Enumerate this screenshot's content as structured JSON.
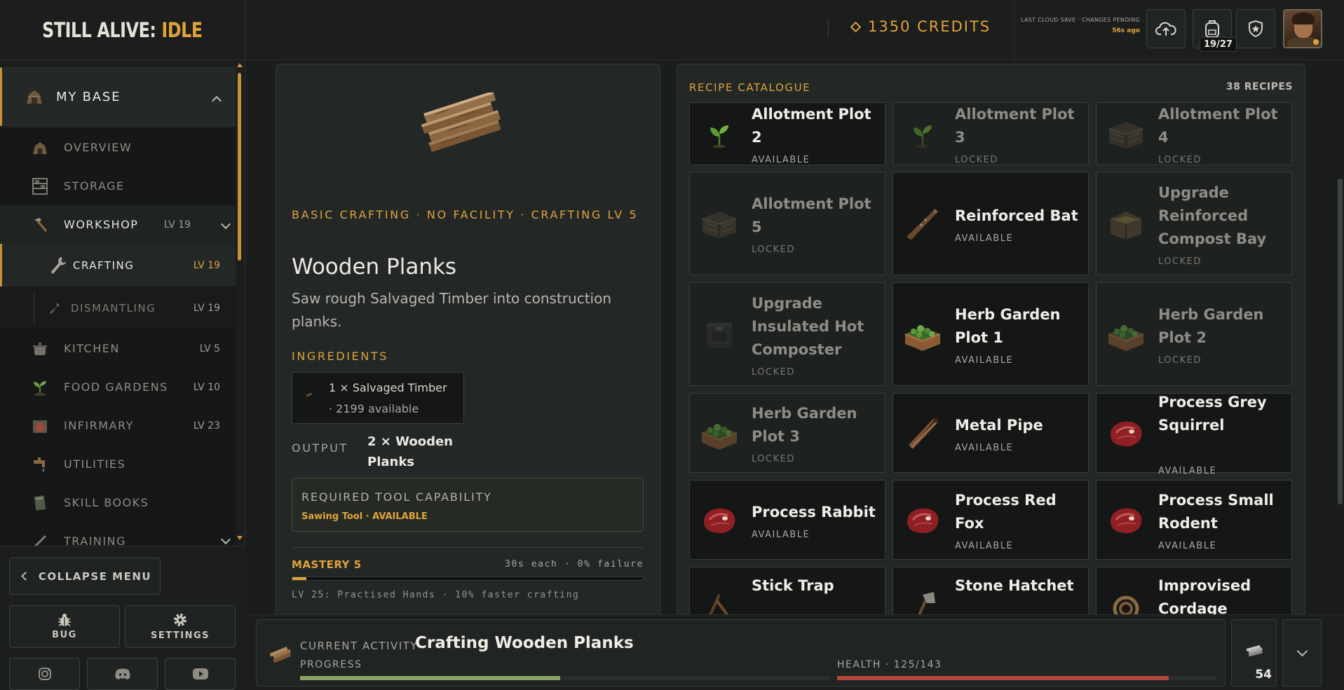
{
  "header": {
    "logo_main": "STILL ALIVE: ",
    "logo_accent": "IDLE",
    "credits": "1350 CREDITS",
    "save_label": "LAST CLOUD SAVE · CHANGES PENDING",
    "save_time": "56s ago",
    "inventory_count": "19/27",
    "icons": [
      "cloud-upload-icon",
      "backpack-icon",
      "shield-star-icon"
    ]
  },
  "sidebar": {
    "section": "MY BASE",
    "items": [
      {
        "label": "OVERVIEW",
        "level": ""
      },
      {
        "label": "STORAGE",
        "level": ""
      },
      {
        "label": "WORKSHOP",
        "level": "LV 19"
      },
      {
        "label": "CRAFTING",
        "level": "LV 19"
      },
      {
        "label": "DISMANTLING",
        "level": "LV 19"
      },
      {
        "label": "KITCHEN",
        "level": "LV 5"
      },
      {
        "label": "FOOD GARDENS",
        "level": "LV 10"
      },
      {
        "label": "INFIRMARY",
        "level": "LV 23"
      },
      {
        "label": "UTILITIES",
        "level": ""
      },
      {
        "label": "SKILL BOOKS",
        "level": ""
      },
      {
        "label": "TRAINING",
        "level": ""
      }
    ],
    "collapse_label": "COLLAPSE MENU",
    "bug_label": "BUG",
    "settings_label": "SETTINGS",
    "social": [
      "instagram-icon",
      "discord-icon",
      "youtube-icon"
    ]
  },
  "detail": {
    "meta": "BASIC CRAFTING · NO FACILITY · CRAFTING LV 5",
    "name": "Wooden Planks",
    "description": "Saw rough Salvaged Timber into construction planks.",
    "ingredients_title": "INGREDIENTS",
    "ingredient_line": "1 × Salvaged Timber",
    "ingredient_available": "2199 available",
    "output_label": "OUTPUT",
    "output_value": "2 × Wooden Planks",
    "tool_title": "REQUIRED TOOL CAPABILITY",
    "tool_status": "Sawing Tool · AVAILABLE",
    "mastery_label": "MASTERY 5",
    "mastery_info": "30s each · 0% failure",
    "mastery_progress": 0.04,
    "mastery_perk": "LV 25: Practised Hands · 10% faster crafting"
  },
  "catalogue": {
    "title": "RECIPE CATALOGUE",
    "count": "38 RECIPES",
    "recipes": [
      {
        "name": "Allotment Plot 2",
        "status": "AVAILABLE",
        "locked": false,
        "icon": "sprout-icon"
      },
      {
        "name": "Allotment Plot 3",
        "status": "LOCKED",
        "locked": true,
        "icon": "sprout-icon"
      },
      {
        "name": "Allotment Plot 4",
        "status": "LOCKED",
        "locked": true,
        "icon": "crate-icon"
      },
      {
        "name": "Allotment Plot 5",
        "status": "LOCKED",
        "locked": true,
        "icon": "crate-icon"
      },
      {
        "name": "Reinforced Bat",
        "status": "AVAILABLE",
        "locked": false,
        "icon": "bat-icon"
      },
      {
        "name": "Upgrade Reinforced Compost Bay",
        "status": "LOCKED",
        "locked": true,
        "icon": "compost-bin-icon"
      },
      {
        "name": "Upgrade Insulated Hot Composter",
        "status": "LOCKED",
        "locked": true,
        "icon": "composter-icon"
      },
      {
        "name": "Herb Garden Plot 1",
        "status": "AVAILABLE",
        "locked": false,
        "icon": "herb-planter-icon"
      },
      {
        "name": "Herb Garden Plot 2",
        "status": "LOCKED",
        "locked": true,
        "icon": "herb-planter-icon"
      },
      {
        "name": "Herb Garden Plot 3",
        "status": "LOCKED",
        "locked": true,
        "icon": "herb-planter-icon"
      },
      {
        "name": "Metal Pipe",
        "status": "AVAILABLE",
        "locked": false,
        "icon": "pipe-icon"
      },
      {
        "name": "Process Grey Squirrel",
        "status": "AVAILABLE",
        "locked": false,
        "icon": "meat-icon"
      },
      {
        "name": "Process Rabbit",
        "status": "AVAILABLE",
        "locked": false,
        "icon": "meat-icon"
      },
      {
        "name": "Process Red Fox",
        "status": "AVAILABLE",
        "locked": false,
        "icon": "meat-icon"
      },
      {
        "name": "Process Small Rodent",
        "status": "AVAILABLE",
        "locked": false,
        "icon": "meat-icon"
      },
      {
        "name": "Stick Trap",
        "status": "",
        "locked": false,
        "icon": "stick-trap-icon"
      },
      {
        "name": "Stone Hatchet",
        "status": "",
        "locked": false,
        "icon": "hatchet-icon"
      },
      {
        "name": "Improvised Cordage",
        "status": "",
        "locked": false,
        "icon": "rope-icon"
      }
    ]
  },
  "activity": {
    "label": "CURRENT ACTIVITY",
    "name": "Crafting Wooden Planks",
    "progress_label": "PROGRESS",
    "progress": 0.49,
    "health_label": "HEALTH · 125/143",
    "health": 0.874,
    "queue_count": "54"
  },
  "colors": {
    "accent": "#e0a33a",
    "progress": "#8aa462",
    "health": "#b5473a",
    "background": "#1a1d1c"
  }
}
